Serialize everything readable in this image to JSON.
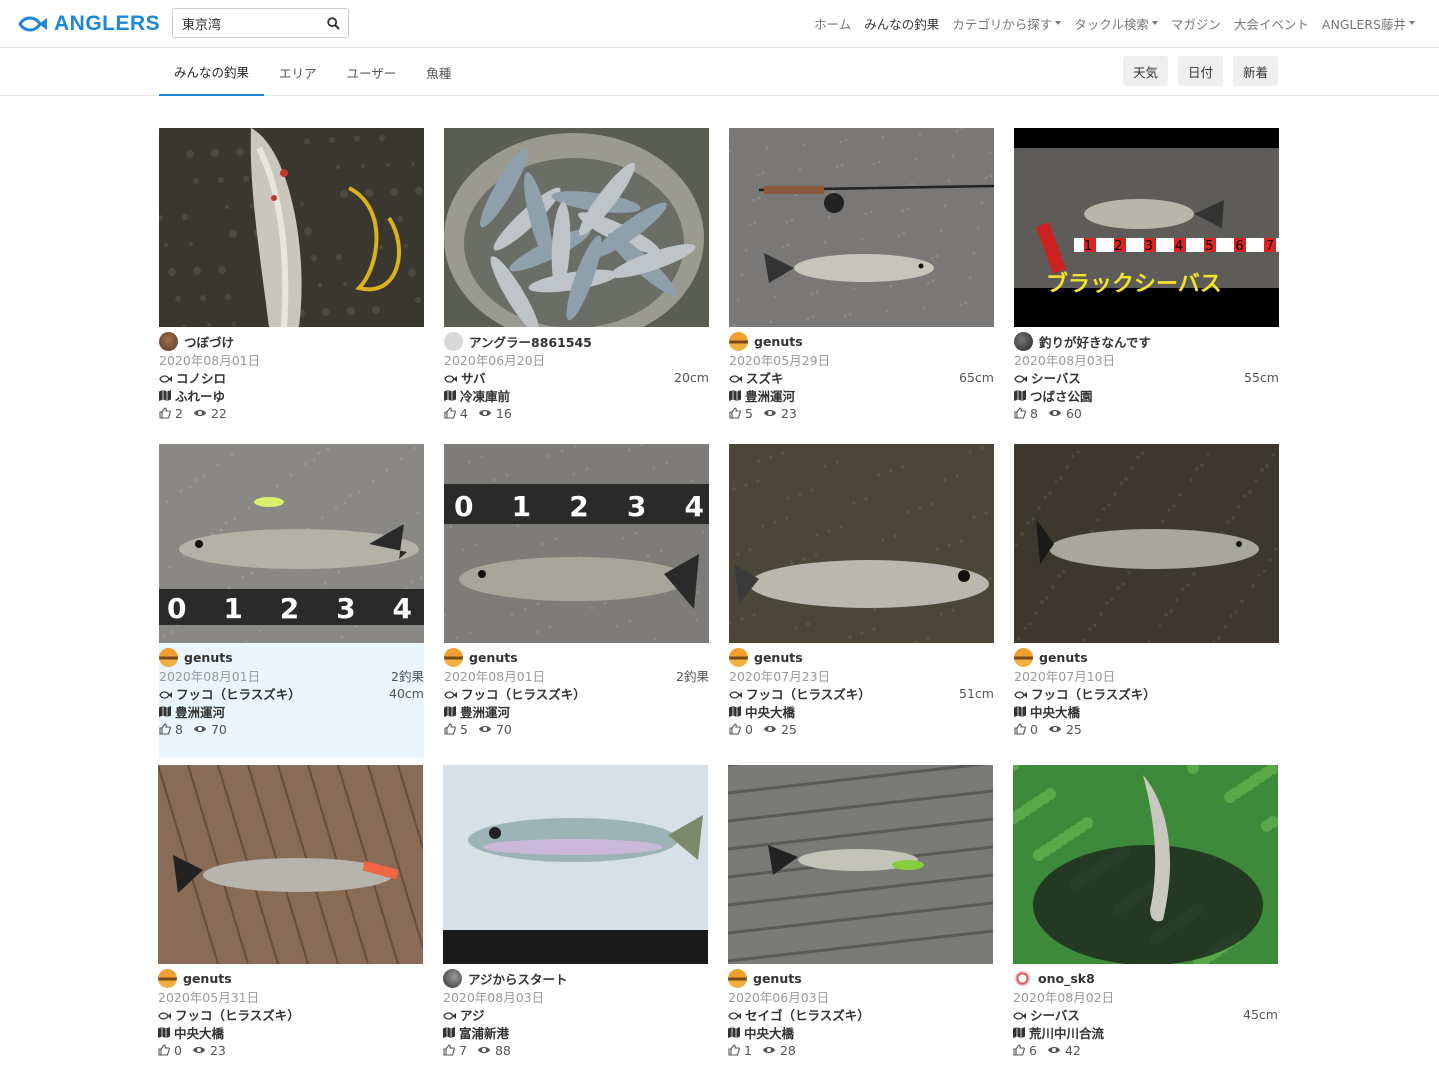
{
  "header": {
    "logo_text": "ANGLERS",
    "search_value": "東京湾",
    "nav": [
      {
        "label": "ホーム",
        "active": false,
        "caret": false
      },
      {
        "label": "みんなの釣果",
        "active": true,
        "caret": false
      },
      {
        "label": "カテゴリから探す",
        "active": false,
        "caret": true
      },
      {
        "label": "タックル検索",
        "active": false,
        "caret": true
      },
      {
        "label": "マガジン",
        "active": false,
        "caret": false
      },
      {
        "label": "大会イベント",
        "active": false,
        "caret": false
      },
      {
        "label": "ANGLERS藤井",
        "active": false,
        "caret": true
      }
    ]
  },
  "subnav": {
    "tabs": [
      {
        "label": "みんなの釣果",
        "active": true
      },
      {
        "label": "エリア",
        "active": false
      },
      {
        "label": "ユーザー",
        "active": false
      },
      {
        "label": "魚種",
        "active": false
      }
    ],
    "sorts": [
      "天気",
      "日付",
      "新着"
    ]
  },
  "colors": {
    "accent": "#1e88d8",
    "highlight": "#eaf5fd"
  },
  "cards": [
    {
      "user": "つぼづけ",
      "date": "2020年08月01日",
      "extra": "",
      "fish": "コノシロ",
      "size": "",
      "place": "ふれーゆ",
      "likes": "2",
      "views": "22",
      "avatar": "brown",
      "photo": "konoshiro"
    },
    {
      "user": "アングラー8861545",
      "date": "2020年06月20日",
      "extra": "",
      "fish": "サバ",
      "size": "20cm",
      "place": "冷凍庫前",
      "likes": "4",
      "views": "16",
      "avatar": "gray",
      "photo": "saba"
    },
    {
      "user": "genuts",
      "date": "2020年05月29日",
      "extra": "",
      "fish": "スズキ",
      "size": "65cm",
      "place": "豊洲運河",
      "likes": "5",
      "views": "23",
      "avatar": "orange",
      "photo": "suzuki"
    },
    {
      "user": "釣りが好きなんです",
      "date": "2020年08月03日",
      "extra": "",
      "fish": "シーバス",
      "size": "55cm",
      "place": "つばさ公園",
      "likes": "8",
      "views": "60",
      "avatar": "dark",
      "photo": "blackseabass"
    },
    {
      "user": "genuts",
      "date": "2020年08月01日",
      "extra": "2釣果",
      "fish": "フッコ（ヒラスズキ）",
      "size": "40cm",
      "place": "豊洲運河",
      "likes": "8",
      "views": "70",
      "avatar": "orange",
      "photo": "fukko1",
      "highlight": true
    },
    {
      "user": "genuts",
      "date": "2020年08月01日",
      "extra": "2釣果",
      "fish": "フッコ（ヒラスズキ）",
      "size": "",
      "place": "豊洲運河",
      "likes": "5",
      "views": "70",
      "avatar": "orange",
      "photo": "fukko2"
    },
    {
      "user": "genuts",
      "date": "2020年07月23日",
      "extra": "",
      "fish": "フッコ（ヒラスズキ）",
      "size": "51cm",
      "place": "中央大橋",
      "likes": "0",
      "views": "25",
      "avatar": "orange",
      "photo": "fukko3"
    },
    {
      "user": "genuts",
      "date": "2020年07月10日",
      "extra": "",
      "fish": "フッコ（ヒラスズキ）",
      "size": "",
      "place": "中央大橋",
      "likes": "0",
      "views": "25",
      "avatar": "orange",
      "photo": "fukko4"
    },
    {
      "user": "genuts",
      "date": "2020年05月31日",
      "extra": "",
      "fish": "フッコ（ヒラスズキ）",
      "size": "",
      "place": "中央大橋",
      "likes": "0",
      "views": "23",
      "avatar": "orange",
      "photo": "fukko5"
    },
    {
      "user": "アジからスタート",
      "date": "2020年08月03日",
      "extra": "",
      "fish": "アジ",
      "size": "",
      "place": "富浦新港",
      "likes": "7",
      "views": "88",
      "avatar": "dark2",
      "photo": "aji"
    },
    {
      "user": "genuts",
      "date": "2020年06月03日",
      "extra": "",
      "fish": "セイゴ（ヒラスズキ）",
      "size": "",
      "place": "中央大橋",
      "likes": "1",
      "views": "28",
      "avatar": "orange",
      "photo": "seigo"
    },
    {
      "user": "ono_sk8",
      "date": "2020年08月02日",
      "extra": "",
      "fish": "シーバス",
      "size": "45cm",
      "place": "荒川中川合流",
      "likes": "6",
      "views": "42",
      "avatar": "red",
      "photo": "seabassnet"
    }
  ],
  "photo_text": {
    "ruler_digits": "0 1 2 3 4",
    "ruler_digits_b": "1 2 3 4 5 6 7",
    "overlay_caption": "ブラックシーバス"
  }
}
